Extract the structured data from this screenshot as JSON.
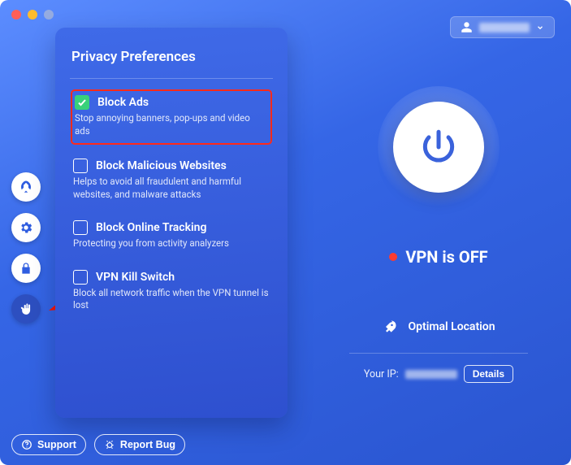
{
  "account": {
    "name_redacted": true
  },
  "sidebar": {
    "items": [
      {
        "id": "boost",
        "icon": "rocket-icon",
        "active": false
      },
      {
        "id": "settings",
        "icon": "gear-icon",
        "active": false
      },
      {
        "id": "security",
        "icon": "lock-icon",
        "active": false
      },
      {
        "id": "privacy",
        "icon": "hand-icon",
        "active": true
      }
    ]
  },
  "panel": {
    "title": "Privacy Preferences",
    "options": [
      {
        "title": "Block Ads",
        "desc": "Stop annoying banners, pop-ups and video ads",
        "checked": true,
        "highlight": true
      },
      {
        "title": "Block Malicious Websites",
        "desc": "Helps to avoid all fraudulent and harmful websites, and malware attacks",
        "checked": false,
        "highlight": false
      },
      {
        "title": "Block Online Tracking",
        "desc": "Protecting you from activity analyzers",
        "checked": false,
        "highlight": false
      },
      {
        "title": "VPN Kill Switch",
        "desc": "Block all network traffic when the VPN tunnel is lost",
        "checked": false,
        "highlight": false
      }
    ]
  },
  "main": {
    "status_text": "VPN is OFF",
    "status_color": "#ff3b30",
    "location_label": "Optimal Location",
    "ip_label": "Your IP:",
    "details_label": "Details"
  },
  "footer": {
    "support_label": "Support",
    "report_label": "Report Bug"
  },
  "annotation": {
    "arrow_points_to": "sidebar-item-privacy",
    "highlight_box_on": "panel.options.0"
  }
}
